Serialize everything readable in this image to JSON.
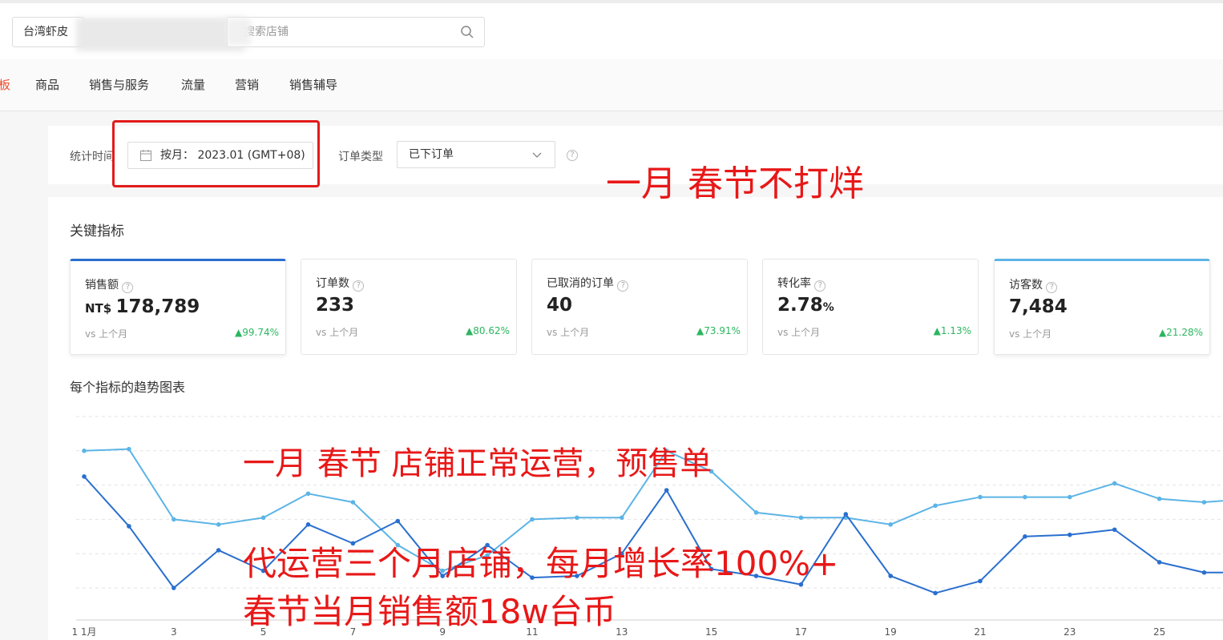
{
  "header": {
    "shop_name": "台湾虾皮",
    "search_placeholder": "搜索店铺"
  },
  "nav": {
    "items": [
      "板",
      "商品",
      "销售与服务",
      "流量",
      "营销",
      "销售辅导"
    ]
  },
  "filters": {
    "time_label": "统计时间",
    "date_value": "按月： 2023.01 (GMT+08)",
    "order_type_label": "订单类型",
    "order_type_value": "已下订单",
    "help": "?"
  },
  "key_metrics": {
    "title": "关键指标",
    "cards": [
      {
        "label": "销售额",
        "prefix": "NT$ ",
        "value": "178,789",
        "unit": "",
        "vs": "vs 上个月",
        "change": "▲99.74%"
      },
      {
        "label": "订单数",
        "prefix": "",
        "value": "233",
        "unit": "",
        "vs": "vs 上个月",
        "change": "▲80.62%"
      },
      {
        "label": "已取消的订单",
        "prefix": "",
        "value": "40",
        "unit": "",
        "vs": "vs 上个月",
        "change": "▲73.91%"
      },
      {
        "label": "转化率",
        "prefix": "",
        "value": "2.78",
        "unit": "%",
        "vs": "vs 上个月",
        "change": "▲1.13%"
      },
      {
        "label": "访客数",
        "prefix": "",
        "value": "7,484",
        "unit": "",
        "vs": "vs 上个月",
        "change": "▲21.28%"
      }
    ]
  },
  "trend": {
    "title": "每个指标的趋势图表"
  },
  "chart_data": {
    "type": "line",
    "x": [
      1,
      2,
      3,
      4,
      5,
      6,
      7,
      8,
      9,
      10,
      11,
      12,
      13,
      14,
      15,
      16,
      17,
      18,
      19,
      20,
      21,
      22,
      23,
      24,
      25,
      26,
      27,
      28
    ],
    "tick_labels": [
      "1 1月",
      "3",
      "5",
      "7",
      "9",
      "11",
      "13",
      "15",
      "17",
      "19",
      "21",
      "23",
      "25"
    ],
    "tick_values": [
      1,
      3,
      5,
      7,
      9,
      11,
      13,
      15,
      17,
      19,
      21,
      23,
      25
    ],
    "ylim": [
      0,
      1
    ],
    "grid": true,
    "series": [
      {
        "color": "#5cb4e6",
        "values": [
          0.8,
          0.81,
          0.4,
          0.37,
          0.41,
          0.55,
          0.5,
          0.25,
          0.1,
          0.19,
          0.4,
          0.41,
          0.41,
          0.8,
          0.68,
          0.44,
          0.41,
          0.41,
          0.37,
          0.48,
          0.53,
          0.53,
          0.53,
          0.61,
          0.52,
          0.5,
          0.52,
          0.52
        ]
      },
      {
        "color": "#2a6fcf",
        "values": [
          0.65,
          0.36,
          0.0,
          0.22,
          0.1,
          0.37,
          0.26,
          0.39,
          0.07,
          0.25,
          0.06,
          0.07,
          0.2,
          0.57,
          0.11,
          0.07,
          0.02,
          0.43,
          0.07,
          -0.03,
          0.04,
          0.3,
          0.31,
          0.34,
          0.15,
          0.09,
          0.09,
          0.09
        ]
      }
    ]
  },
  "annotations": {
    "a1": "一月 春节不打烊",
    "a2": "一月 春节 店铺正常运营，预售单",
    "a3": "代运营三个月店铺，每月增长率100%+",
    "a4": "春节当月销售额18w台币"
  }
}
